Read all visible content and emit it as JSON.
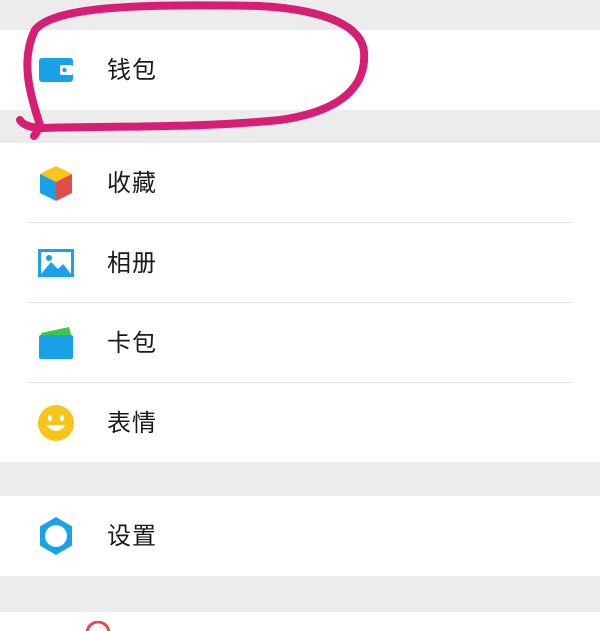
{
  "menu": {
    "wallet": {
      "label": "钱包",
      "icon": "wallet-icon"
    },
    "favorites": {
      "label": "收藏",
      "icon": "cube-icon"
    },
    "album": {
      "label": "相册",
      "icon": "picture-icon"
    },
    "cards": {
      "label": "卡包",
      "icon": "card-icon"
    },
    "stickers": {
      "label": "表情",
      "icon": "smiley-icon"
    },
    "settings": {
      "label": "设置",
      "icon": "gear-icon"
    }
  },
  "colors": {
    "page_background": "#ececec",
    "row_background": "#ffffff",
    "divider": "#e6e6e6",
    "icon_blue": "#1aa2e8",
    "icon_green": "#3cc74a",
    "icon_yellow": "#f5c518",
    "icon_red": "#e54b4b",
    "annotation_pink": "#d61f74"
  }
}
